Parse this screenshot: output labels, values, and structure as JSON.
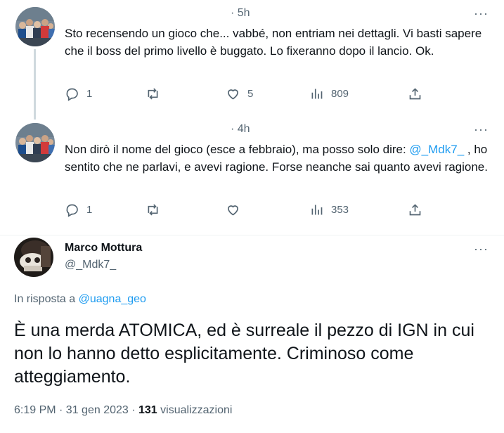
{
  "replies": [
    {
      "time": "· 5h",
      "text": "Sto recensendo un gioco che... vabbé, non entriam nei dettagli. Vi basti sapere che il boss del primo livello è buggato. Lo fixeranno dopo il lancio. Ok.",
      "actions": {
        "reply_count": "1",
        "retweet_count": "",
        "like_count": "5",
        "views_count": "809"
      }
    },
    {
      "time": "· 4h",
      "text_before_mention": "Non dirò il nome del gioco (esce a febbraio), ma posso solo dire: ",
      "mention": "@_Mdk7_",
      "text_after_mention": " , ho sentito che ne parlavi, e avevi ragione. Forse neanche sai quanto avevi ragione.",
      "actions": {
        "reply_count": "1",
        "retweet_count": "",
        "like_count": "",
        "views_count": "353"
      }
    }
  ],
  "main_tweet": {
    "author_name": "Marco Mottura",
    "author_handle": "@_Mdk7_",
    "reply_prefix": "In risposta a ",
    "reply_to_handle": "@uagna_geo",
    "text": "È una merda ATOMICA, ed è surreale il pezzo di IGN in cui non lo hanno detto esplicitamente. Criminoso come atteggiamento.",
    "timestamp": "6:19 PM · 31 gen 2023 · ",
    "views_count": "131",
    "views_label": " visualizzazioni"
  },
  "icons": {
    "more": "more-icon",
    "reply": "reply-icon",
    "retweet": "retweet-icon",
    "like": "like-icon",
    "views": "views-icon",
    "share": "share-icon"
  },
  "colors": {
    "link": "#1d9bf0",
    "secondary_text": "#536471",
    "primary_text": "#0f1419",
    "thread_line": "#cfd9de"
  }
}
